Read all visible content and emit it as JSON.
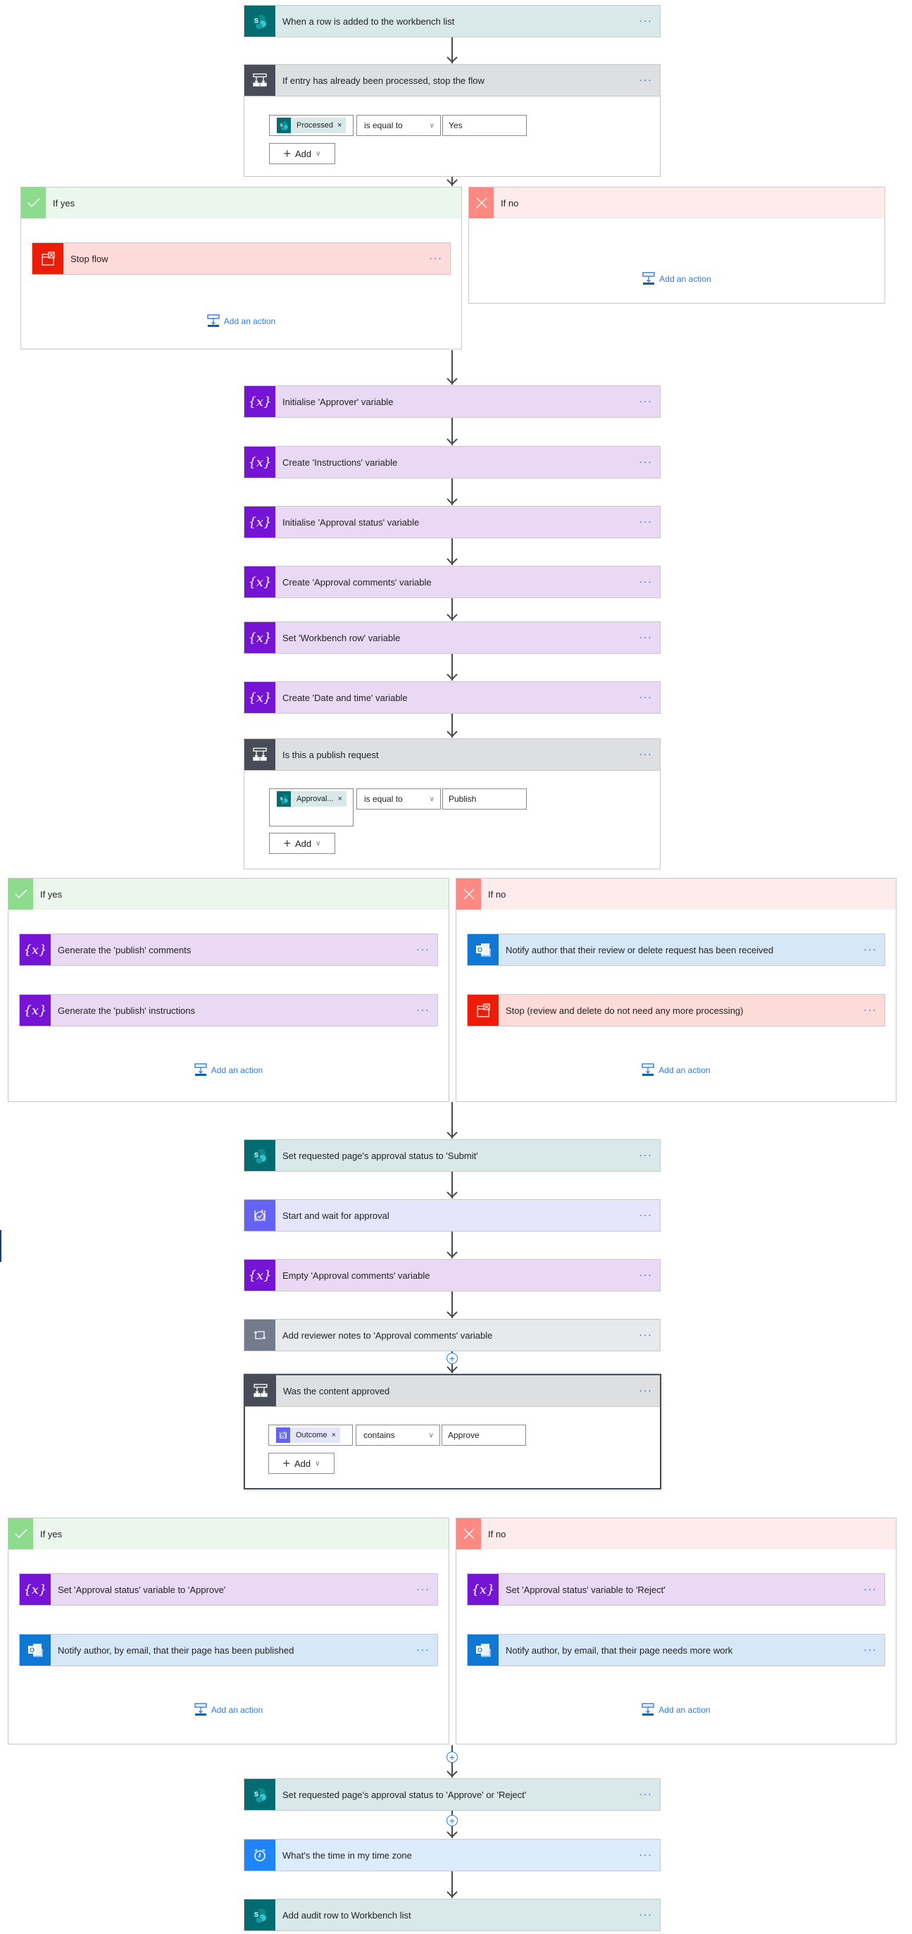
{
  "trigger": {
    "label": "When a row is added to the workbench list",
    "icon": "sharepoint-icon"
  },
  "condition1": {
    "label": "If entry has already been processed, stop the flow",
    "token": "Processed",
    "operator": "is equal to",
    "value": "Yes",
    "add_label": "Add",
    "yes": {
      "label": "If yes",
      "actions": [
        {
          "label": "Stop flow",
          "type": "stop"
        }
      ],
      "add_action": "Add an action"
    },
    "no": {
      "label": "If no",
      "actions": [],
      "add_action": "Add an action"
    }
  },
  "variables": [
    {
      "label": "Initialise 'Approver' variable"
    },
    {
      "label": "Create 'Instructions' variable"
    },
    {
      "label": "Initialise 'Approval status' variable"
    },
    {
      "label": "Create 'Approval comments' variable"
    },
    {
      "label": "Set 'Workbench row' variable"
    },
    {
      "label": "Create 'Date and time' variable"
    }
  ],
  "condition2": {
    "label": "Is this a publish request",
    "token": "Approval...",
    "operator": "is equal to",
    "value": "Publish",
    "add_label": "Add",
    "yes": {
      "label": "If yes",
      "actions": [
        {
          "label": "Generate the 'publish' comments",
          "type": "variable"
        },
        {
          "label": "Generate the 'publish' instructions",
          "type": "variable"
        }
      ],
      "add_action": "Add an action"
    },
    "no": {
      "label": "If no",
      "actions": [
        {
          "label": "Notify author that their review or delete request has been received",
          "type": "outlook"
        },
        {
          "label": "Stop (review and delete do not need any more processing)",
          "type": "stop"
        }
      ],
      "add_action": "Add an action"
    }
  },
  "middle_actions": [
    {
      "label": "Set requested page's approval status to 'Submit'",
      "type": "sharepoint"
    },
    {
      "label": "Start and wait for approval",
      "type": "approval"
    },
    {
      "label": "Empty 'Approval comments' variable",
      "type": "variable"
    },
    {
      "label": "Add reviewer notes to 'Approval comments' variable",
      "type": "compose"
    }
  ],
  "condition3": {
    "label": "Was the content approved",
    "token": "Outcome",
    "operator": "contains",
    "value": "Approve",
    "add_label": "Add",
    "yes": {
      "label": "If yes",
      "actions": [
        {
          "label": "Set 'Approval status' variable to 'Approve'",
          "type": "variable"
        },
        {
          "label": "Notify author, by email, that their page has been published",
          "type": "outlook"
        }
      ],
      "add_action": "Add an action"
    },
    "no": {
      "label": "If no",
      "actions": [
        {
          "label": "Set 'Approval status' variable to 'Reject'",
          "type": "variable"
        },
        {
          "label": "Notify author, by email, that their page needs more work",
          "type": "outlook"
        }
      ],
      "add_action": "Add an action"
    }
  },
  "final_actions": [
    {
      "label": "Set requested page's approval status to 'Approve' or 'Reject'",
      "type": "sharepoint"
    },
    {
      "label": "What's the time in my time zone",
      "type": "time"
    },
    {
      "label": "Add audit row to Workbench list",
      "type": "sharepoint"
    }
  ],
  "more_label": "...",
  "colors": {
    "sharepoint": "#036c70",
    "variable": "#7514d4",
    "condition": "#474c57",
    "stop": "#ec1c07",
    "outlook": "#0f78d4",
    "approval": "#6363f5",
    "compose": "#737c8c",
    "time": "#1f85ff",
    "yes": "#8cdb8e",
    "no": "#fc8a83",
    "link": "#2f7bd8"
  }
}
